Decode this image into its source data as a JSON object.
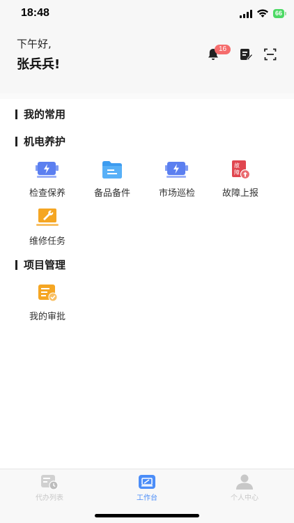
{
  "status": {
    "time": "18:48",
    "battery": "66"
  },
  "header": {
    "greeting": "下午好,",
    "user_name": "张兵兵!",
    "notification_count": "16"
  },
  "sections": {
    "favorites": {
      "title": "我的常用"
    },
    "maintenance": {
      "title": "机电养护",
      "items": [
        {
          "label": "检查保养",
          "icon": "motor-icon"
        },
        {
          "label": "备品备件",
          "icon": "folder-icon"
        },
        {
          "label": "市场巡检",
          "icon": "motor-icon"
        },
        {
          "label": "故障上报",
          "icon": "fault-report-icon"
        },
        {
          "label": "维修任务",
          "icon": "wrench-icon"
        }
      ]
    },
    "project": {
      "title": "项目管理",
      "items": [
        {
          "label": "我的审批",
          "icon": "approval-icon"
        }
      ]
    }
  },
  "tabbar": {
    "tabs": [
      {
        "label": "代办列表",
        "icon": "todo-list-icon",
        "active": false
      },
      {
        "label": "工作台",
        "icon": "workbench-icon",
        "active": true
      },
      {
        "label": "个人中心",
        "icon": "user-icon",
        "active": false
      }
    ]
  },
  "colors": {
    "accent": "#4b8df8",
    "badge": "#f56c6c",
    "warning": "#f5a623",
    "danger": "#e0464f"
  }
}
